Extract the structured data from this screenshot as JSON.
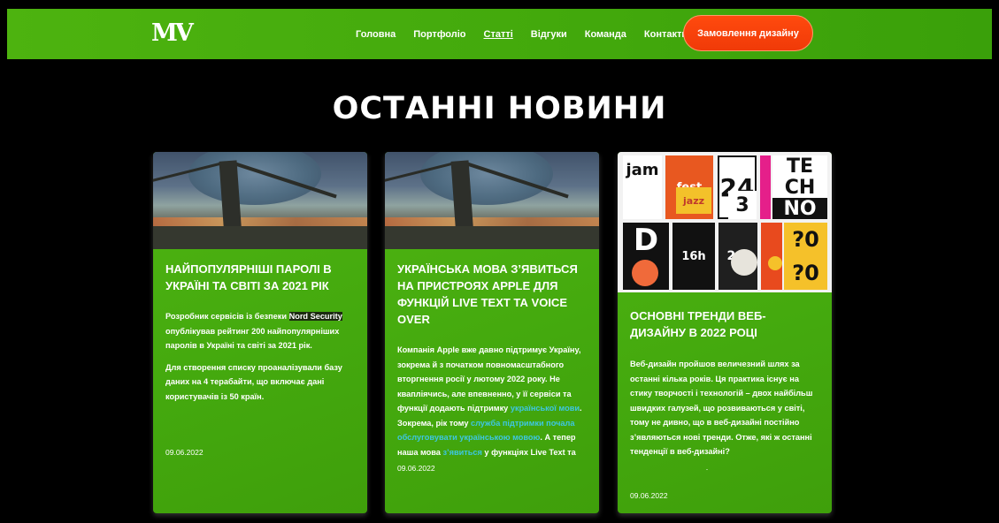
{
  "header": {
    "logo": "MV",
    "nav": [
      "Головна",
      "Портфоліо",
      "Статті",
      "Відгуки",
      "Команда",
      "Контакти"
    ],
    "active_nav": "Статті",
    "cta_label": "Замовлення дизайну",
    "bar_color": "#46ad0d",
    "cta_color": "#f5400b"
  },
  "section": {
    "title": "ОСТАННІ НОВИНИ"
  },
  "cards": [
    {
      "title": "Найпопулярніші паролі в Україні та світі за 2021 рік",
      "p1_a": "Розробник сервісів із безпеки ",
      "p1_hl": "Nord Security",
      "p1_b": " опублікував рейтинг 200 найпопулярніших паролів в Україні та світі за 2021 рік.",
      "p2": "Для створення списку проаналізували базу даних на 4 терабайти, що включає дані користувачів із 50 країн.",
      "date": "09.06.2022"
    },
    {
      "title": "Українська мова з’явиться на пристроях Apple для функцій Live Text та Voice Over",
      "t1": "Компанія Apple вже давно підтримує Україну, зокрема й з початком повномасштабного вторгнення росії у лютому 2022 року. Не квапліячись, але впевненно, у її сервіси та функції додають підтримку ",
      "l1": "української мови",
      "t2": ". Зокрема, рік тому ",
      "l2": "служба підтримки почала обслуговувати українською мовою",
      "t3": ". А тепер наша мова ",
      "l3": "з’явиться",
      "t4": " у функціях Live Text та",
      "date": "09.06.2022"
    },
    {
      "title": "Основні тренди веб-дизайну в 2022 році",
      "text": "Веб-дизайн пройшов величезний шлях за останні кілька років. Ця практика існує на стику творчості і технологій – двох найбільш швидких галузей, що розвиваються у світі, тому не дивно, що в веб-дизайні постійно з’являються нові тренди. Отже, які ж останні тенденції в веб-дизайні?",
      "dot": ".",
      "date": "09.06.2022",
      "poster_labels": [
        "jam",
        "fest",
        "jazz",
        "24",
        "3",
        "TE",
        "CH",
        "NO",
        "D",
        "16h",
        "20:",
        "?0",
        "?0"
      ]
    }
  ]
}
